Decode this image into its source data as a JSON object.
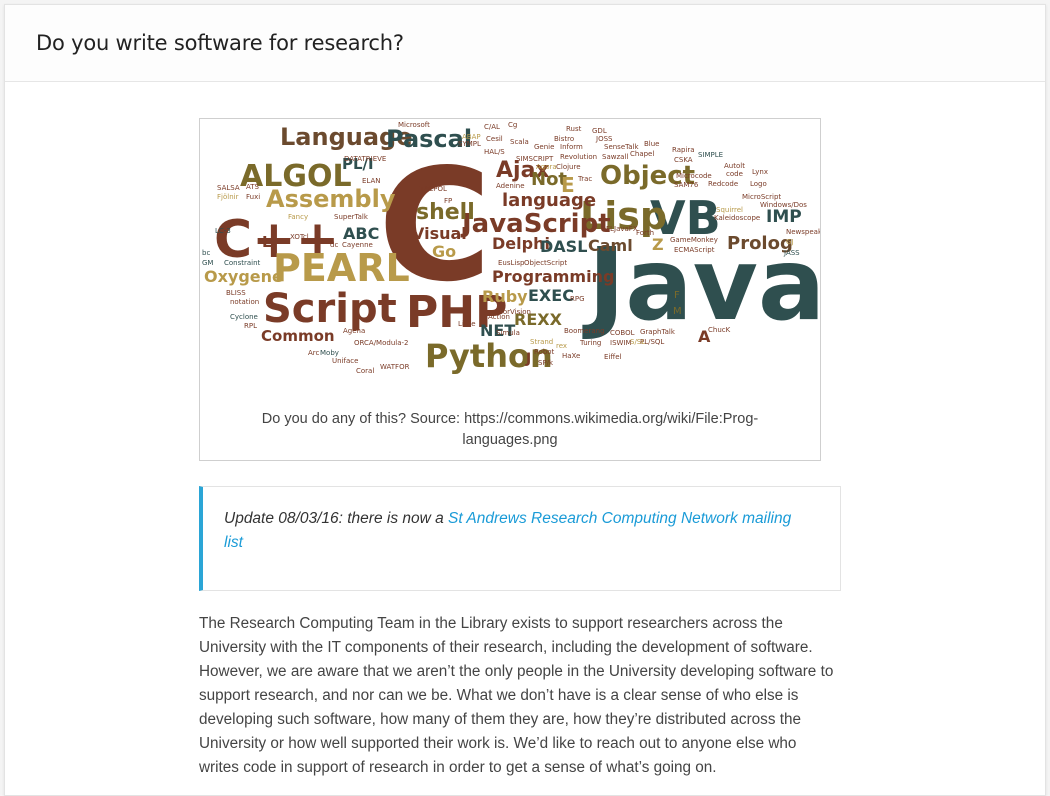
{
  "post": {
    "title": "Do you write software for research?"
  },
  "figure": {
    "caption_line1": "Do you do any of this? Source: https://commons.wikimedia.org/wiki/File:Prog-",
    "caption_line2": "languages.png",
    "words": [
      {
        "t": "Java",
        "c": "#2f4f4f"
      },
      {
        "t": "C",
        "c": "#7a3b27"
      },
      {
        "t": "C++",
        "c": "#7a3b27"
      },
      {
        "t": "PHP",
        "c": "#7a3b27"
      },
      {
        "t": "PEARL",
        "c": "#b89a4a"
      },
      {
        "t": "Script",
        "c": "#7a3b27"
      },
      {
        "t": "Python",
        "c": "#7a6a2a"
      },
      {
        "t": "VB",
        "c": "#2f4f4f"
      },
      {
        "t": "Lisp",
        "c": "#7a6a2a"
      },
      {
        "t": "ALGOL",
        "c": "#7a6a2a"
      },
      {
        "t": "Object",
        "c": "#7a6a2a"
      },
      {
        "t": "Language",
        "c": "#6b4a2e"
      },
      {
        "t": "Pascal",
        "c": "#2f4f4f"
      },
      {
        "t": "Assembly",
        "c": "#b89a4a"
      },
      {
        "t": "JavaScript",
        "c": "#7a3b27"
      },
      {
        "t": "shell",
        "c": "#7a6a2a"
      },
      {
        "t": "Ajax",
        "c": "#7a3b27"
      },
      {
        "t": "Prolog",
        "c": "#6b4a2e"
      },
      {
        "t": "Oxygene",
        "c": "#b89a4a"
      },
      {
        "t": "Programming",
        "c": "#7a3b27"
      },
      {
        "t": "language",
        "c": "#7a3b27"
      },
      {
        "t": "Delphi",
        "c": "#7a3b27"
      },
      {
        "t": "DASL",
        "c": "#2f4f4f"
      },
      {
        "t": "Caml",
        "c": "#6b4a2e"
      },
      {
        "t": "Visual",
        "c": "#7a3b27"
      },
      {
        "t": "Go",
        "c": "#b89a4a"
      },
      {
        "t": "Ruby",
        "c": "#b89a4a"
      },
      {
        "t": "EXEC",
        "c": "#2f4f4f"
      },
      {
        "t": "REXX",
        "c": "#7a6a2a"
      },
      {
        "t": "NET",
        "c": "#2f4f4f"
      },
      {
        "t": "Common",
        "c": "#7a3b27"
      },
      {
        "t": "ABC",
        "c": "#2f4f4f"
      },
      {
        "t": "PL/I",
        "c": "#2f4f4f"
      },
      {
        "t": "IMP",
        "c": "#2f4f4f"
      },
      {
        "t": "Not",
        "c": "#7a6a2a"
      },
      {
        "t": "E",
        "c": "#b89a4a"
      },
      {
        "t": "Z",
        "c": "#b89a4a"
      },
      {
        "t": "L",
        "c": "#7a3b27"
      },
      {
        "t": "J",
        "c": "#7a3b27"
      },
      {
        "t": "A",
        "c": "#7a3b27"
      },
      {
        "t": "F",
        "c": "#7a6a2a"
      },
      {
        "t": "M",
        "c": "#7a6a2a"
      },
      {
        "t": "Microsoft",
        "c": "#7a3b27"
      },
      {
        "t": "C/AL",
        "c": "#7a3b27"
      },
      {
        "t": "Cg",
        "c": "#7a3b27"
      },
      {
        "t": "Rust",
        "c": "#7a3b27"
      },
      {
        "t": "GDL",
        "c": "#7a3b27"
      },
      {
        "t": "JOSS",
        "c": "#7a3b27"
      },
      {
        "t": "Scala",
        "c": "#7a3b27"
      },
      {
        "t": "Genie",
        "c": "#7a3b27"
      },
      {
        "t": "Inform",
        "c": "#7a3b27"
      },
      {
        "t": "Bistro",
        "c": "#7a3b27"
      },
      {
        "t": "SenseTalk",
        "c": "#7a3b27"
      },
      {
        "t": "Blue",
        "c": "#7a3b27"
      },
      {
        "t": "Sawzall",
        "c": "#7a3b27"
      },
      {
        "t": "Chapel",
        "c": "#7a3b27"
      },
      {
        "t": "Rapira",
        "c": "#7a3b27"
      },
      {
        "t": "CSKA",
        "c": "#7a3b27"
      },
      {
        "t": "SIMPLE",
        "c": "#2f4f4f"
      },
      {
        "t": "ABAP",
        "c": "#b89a4a"
      },
      {
        "t": "SYMPL",
        "c": "#7a3b27"
      },
      {
        "t": "Cesil",
        "c": "#7a3b27"
      },
      {
        "t": "HAL/S",
        "c": "#7a3b27"
      },
      {
        "t": "SIMSCRIPT",
        "c": "#7a3b27"
      },
      {
        "t": "Revolution",
        "c": "#7a3b27"
      },
      {
        "t": "Agora",
        "c": "#b89a4a"
      },
      {
        "t": "Clojure",
        "c": "#7a3b27"
      },
      {
        "t": "DATATRIEVE",
        "c": "#7a3b27"
      },
      {
        "t": "ELAN",
        "c": "#7a3b27"
      },
      {
        "t": "Adenine",
        "c": "#7a3b27"
      },
      {
        "t": "Trac",
        "c": "#7a3b27"
      },
      {
        "t": "Microcode",
        "c": "#7a3b27"
      },
      {
        "t": "SAM76",
        "c": "#7a3b27"
      },
      {
        "t": "Redcode",
        "c": "#7a3b27"
      },
      {
        "t": "Autolt",
        "c": "#7a3b27"
      },
      {
        "t": "code",
        "c": "#7a3b27"
      },
      {
        "t": "Lynx",
        "c": "#7a3b27"
      },
      {
        "t": "Logo",
        "c": "#7a3b27"
      },
      {
        "t": "MicroScript",
        "c": "#7a3b27"
      },
      {
        "t": "Windows/Dos",
        "c": "#7a3b27"
      },
      {
        "t": "Squirrel",
        "c": "#b89a4a"
      },
      {
        "t": "Kaleidoscope",
        "c": "#7a3b27"
      },
      {
        "t": "Newspeak",
        "c": "#7a3b27"
      },
      {
        "t": "GJ",
        "c": "#b89a4a"
      },
      {
        "t": "JASS",
        "c": "#2f4f4f"
      },
      {
        "t": "GameMonkey",
        "c": "#7a3b27"
      },
      {
        "t": "ECMAScript",
        "c": "#7a3b27"
      },
      {
        "t": "Forth",
        "c": "#7a3b27"
      },
      {
        "t": "FL",
        "c": "#7a3b27"
      },
      {
        "t": "JavaFX",
        "c": "#7a3b27"
      },
      {
        "t": "SALSA",
        "c": "#7a3b27"
      },
      {
        "t": "ATS",
        "c": "#7a3b27"
      },
      {
        "t": "Fjölnir",
        "c": "#b89a4a"
      },
      {
        "t": "Fuxi",
        "c": "#7a3b27"
      },
      {
        "t": "Fancy",
        "c": "#b89a4a"
      },
      {
        "t": "SuperTalk",
        "c": "#7a3b27"
      },
      {
        "t": "TACPOL",
        "c": "#7a3b27"
      },
      {
        "t": "FP",
        "c": "#7a3b27"
      },
      {
        "t": "LC-3",
        "c": "#2f4f4f"
      },
      {
        "t": "XOTcl",
        "c": "#7a3b27"
      },
      {
        "t": "dc",
        "c": "#7a3b27"
      },
      {
        "t": "Cayenne",
        "c": "#7a3b27"
      },
      {
        "t": "bc",
        "c": "#2f4f4f"
      },
      {
        "t": "GM",
        "c": "#2f4f4f"
      },
      {
        "t": "Constraint",
        "c": "#2f4f4f"
      },
      {
        "t": "BLISS",
        "c": "#7a3b27"
      },
      {
        "t": "notation",
        "c": "#7a3b27"
      },
      {
        "t": "Cyclone",
        "c": "#2f4f4f"
      },
      {
        "t": "RPL",
        "c": "#7a3b27"
      },
      {
        "t": "Agena",
        "c": "#7a3b27"
      },
      {
        "t": "ORCA/Modula-2",
        "c": "#7a3b27"
      },
      {
        "t": "Arc",
        "c": "#7a3b27"
      },
      {
        "t": "Moby",
        "c": "#2f4f4f"
      },
      {
        "t": "Uniface",
        "c": "#7a3b27"
      },
      {
        "t": "Coral",
        "c": "#7a3b27"
      },
      {
        "t": "WATFOR",
        "c": "#7a3b27"
      },
      {
        "t": "EusLisp",
        "c": "#7a3b27"
      },
      {
        "t": "ObjectScript",
        "c": "#7a3b27"
      },
      {
        "t": "RPG",
        "c": "#7a3b27"
      },
      {
        "t": "CorVision",
        "c": "#7a3b27"
      },
      {
        "t": "Action",
        "c": "#7a3b27"
      },
      {
        "t": "Simula",
        "c": "#7a3b27"
      },
      {
        "t": "Little",
        "c": "#7a3b27"
      },
      {
        "t": "Strand",
        "c": "#b89a4a"
      },
      {
        "t": "rex",
        "c": "#b89a4a"
      },
      {
        "t": "Robot",
        "c": "#7a3b27"
      },
      {
        "t": "SP/k",
        "c": "#7a3b27"
      },
      {
        "t": "Boomerang",
        "c": "#7a3b27"
      },
      {
        "t": "COBOL",
        "c": "#7a3b27"
      },
      {
        "t": "Turing",
        "c": "#7a3b27"
      },
      {
        "t": "ISWIM",
        "c": "#7a3b27"
      },
      {
        "t": "HaXe",
        "c": "#7a3b27"
      },
      {
        "t": "Eiffel",
        "c": "#7a3b27"
      },
      {
        "t": "GraphTalk",
        "c": "#7a3b27"
      },
      {
        "t": "PL/SQL",
        "c": "#7a3b27"
      },
      {
        "t": "S/SL",
        "c": "#b89a4a"
      },
      {
        "t": "ChucK",
        "c": "#7a3b27"
      }
    ]
  },
  "update": {
    "prefix": "Update 08/03/16: there is now a ",
    "link": "St Andrews Research Computing Network mailing list"
  },
  "body": {
    "paragraph1": "The Research Computing Team in the Library exists to support researchers across the University with the IT components of their research, including the development of software. However, we are aware that we aren’t the only people in the University developing software to support research, and nor can we be. What we don’t have is a clear sense of who else is developing such software, how many of them they are, how they’re distributed across the University or how well supported their work is. We’d like to reach out to anyone else who writes code in support of research in order to get a sense of what’s going on."
  }
}
